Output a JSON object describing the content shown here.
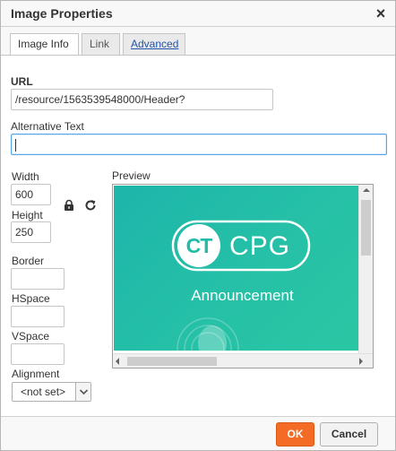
{
  "dialog": {
    "title": "Image Properties"
  },
  "tabs": [
    {
      "label": "Image Info"
    },
    {
      "label": "Link"
    },
    {
      "label": "Advanced"
    }
  ],
  "form": {
    "url_label": "URL",
    "url_value": "/resource/1563539548000/Header?",
    "alt_label": "Alternative Text",
    "alt_value": "",
    "width_label": "Width",
    "width_value": "600",
    "height_label": "Height",
    "height_value": "250",
    "border_label": "Border",
    "border_value": "",
    "hspace_label": "HSpace",
    "hspace_value": "",
    "vspace_label": "VSpace",
    "vspace_value": "",
    "alignment_label": "Alignment",
    "alignment_value": "<not set>"
  },
  "preview": {
    "label": "Preview",
    "logo_initials": "CT",
    "logo_text": "CPG",
    "subtitle": "Announcement",
    "colors": {
      "gradient_start": "#1db5ab",
      "gradient_end": "#2bc7a3"
    }
  },
  "footer": {
    "ok_label": "OK",
    "cancel_label": "Cancel"
  },
  "colors": {
    "accent": "#f36b25",
    "focus": "#59a5e5",
    "link": "#2255aa"
  }
}
